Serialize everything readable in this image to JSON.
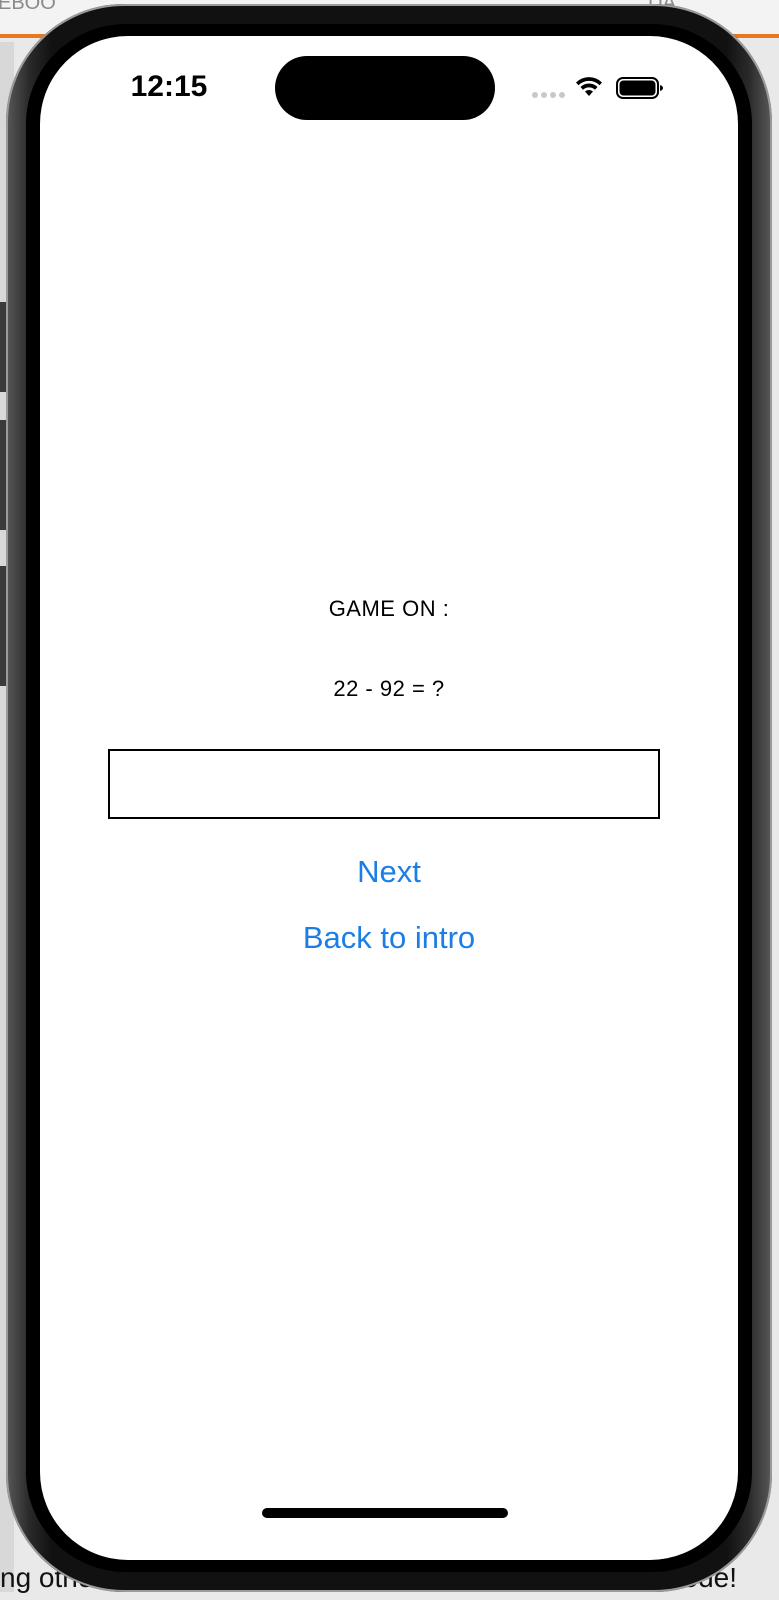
{
  "background": {
    "top_left_fragment": "EBOO",
    "top_right_fragment": "DA",
    "bottom_left_fragment": "ng other",
    "bottom_right_fragment": "ode!"
  },
  "status_bar": {
    "time": "12:15"
  },
  "game": {
    "title": "GAME ON :",
    "question": "22 - 92 = ?",
    "answer_value": "",
    "answer_placeholder": "",
    "next_label": "Next",
    "back_label": "Back to intro"
  },
  "colors": {
    "link": "#1a7ee6",
    "accent_bar": "#e8771e"
  }
}
